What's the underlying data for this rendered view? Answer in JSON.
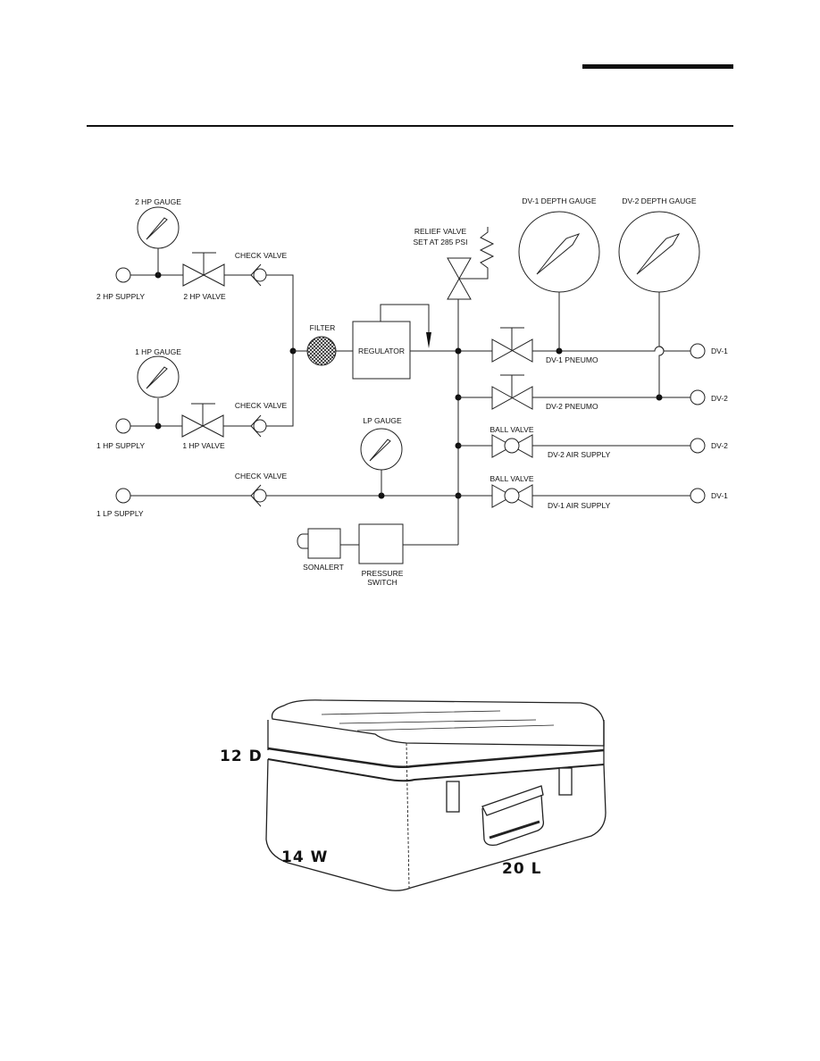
{
  "schematic": {
    "gauges": {
      "hp2": "2 HP GAUGE",
      "hp1": "1 HP GAUGE",
      "lp": "LP GAUGE",
      "dv1_depth": "DV-1 DEPTH GAUGE",
      "dv2_depth": "DV-2 DEPTH GAUGE"
    },
    "supplies": {
      "hp2": "2 HP SUPPLY",
      "hp1": "1 HP SUPPLY",
      "lp1": "1 LP SUPPLY"
    },
    "valves": {
      "hp2": "2 HP VALVE",
      "hp1": "1 HP VALVE",
      "check": "CHECK VALVE",
      "relief_line1": "RELIEF VALVE",
      "relief_line2": "SET AT 285 PSI",
      "ball": "BALL VALVE"
    },
    "filter": "FILTER",
    "regulator": "REGULATOR",
    "lines": {
      "dv1_pneumo": "DV-1 PNEUMO",
      "dv2_pneumo": "DV-2 PNEUMO",
      "dv2_air": "DV-2 AIR SUPPLY",
      "dv1_air": "DV-1 AIR SUPPLY"
    },
    "outlets": {
      "dv1": "DV-1",
      "dv2": "DV-2"
    },
    "sonalert": "SONALERT",
    "pressure_switch_line1": "PRESSURE",
    "pressure_switch_line2": "SWITCH"
  },
  "case_dimensions": {
    "depth": "12 D",
    "width": "14 W",
    "length": "20 L"
  }
}
